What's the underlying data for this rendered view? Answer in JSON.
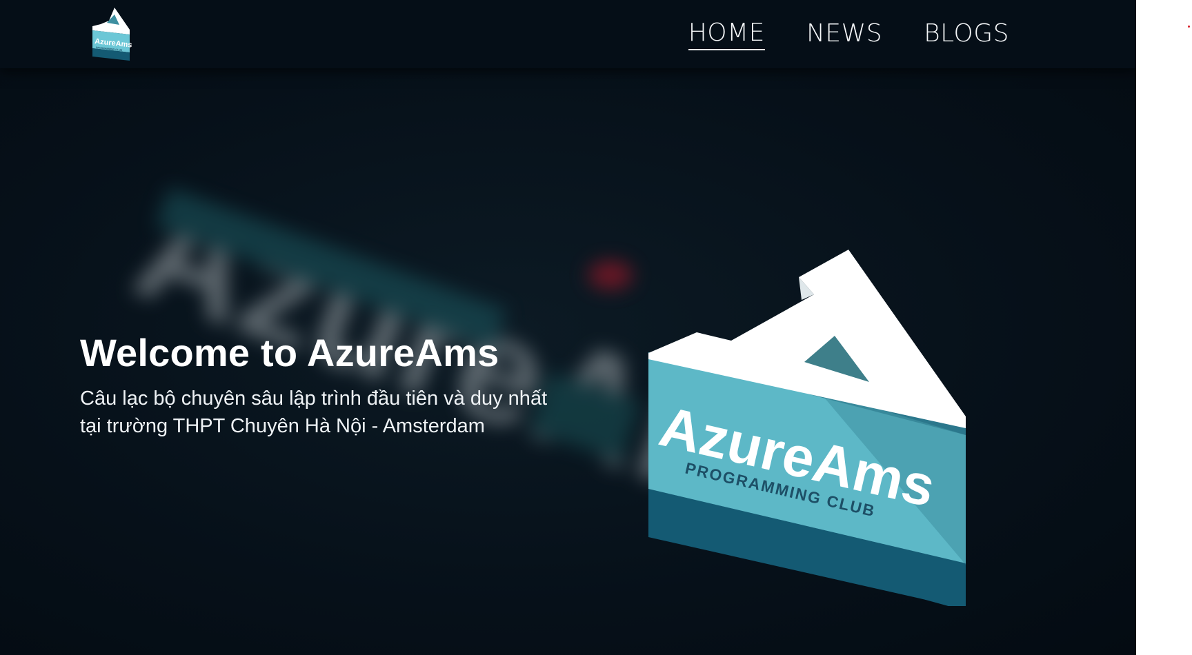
{
  "nav": {
    "logo_text": "AzureAms",
    "logo_sub": "PROGRAMMING CLUB",
    "links": [
      {
        "label": "HOME",
        "active": true
      },
      {
        "label": "NEWS",
        "active": false
      },
      {
        "label": "BLOGS",
        "active": false
      }
    ]
  },
  "hero": {
    "title": "Welcome to AzureAms",
    "subtitle_line1": "Câu lạc bộ chuyên sâu lập trình đầu tiên và duy nhất",
    "subtitle_line2": "tại trường THPT Chuyên Hà Nội - Amsterdam",
    "logo_text": "AzureAms",
    "logo_sub": "PROGRAMMING CLUB",
    "background_text": "AzureAms"
  },
  "colors": {
    "nav_bg": "#050e17",
    "hero_bg": "#061019",
    "logo_top": "#ffffff",
    "logo_light": "#6cc7d6",
    "logo_mid": "#3e8fa0",
    "logo_dark": "#145a73",
    "logo_text": "#1d4f66"
  },
  "icons": {
    "brand_logo": "azureams-logo-icon"
  }
}
